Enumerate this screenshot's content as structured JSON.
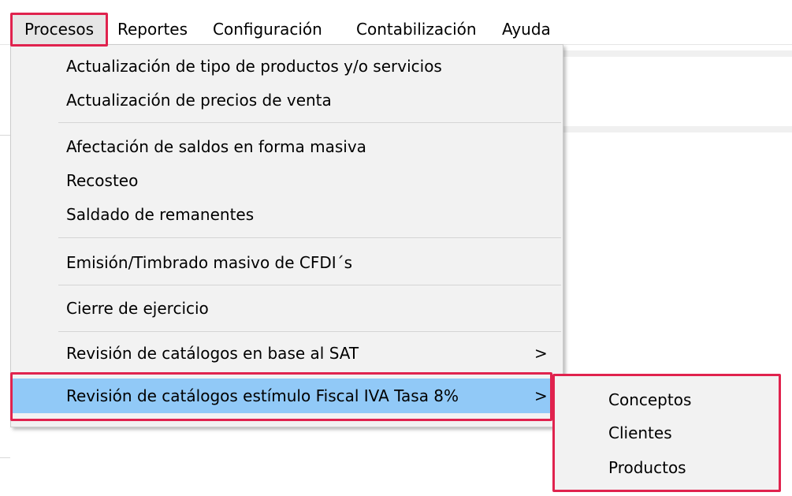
{
  "menubar": {
    "items": [
      {
        "label": "Procesos"
      },
      {
        "label": "Reportes"
      },
      {
        "label": "Configuración"
      },
      {
        "label": "Contabilización"
      },
      {
        "label": "Ayuda"
      }
    ]
  },
  "dropdown": {
    "items": [
      {
        "label": "Actualización de tipo de productos y/o servicios"
      },
      {
        "label": "Actualización de precios de venta"
      },
      {
        "label": "Afectación de saldos en forma masiva"
      },
      {
        "label": "Recosteo"
      },
      {
        "label": "Saldado de remanentes"
      },
      {
        "label": "Emisión/Timbrado masivo de CFDI´s"
      },
      {
        "label": "Cierre de ejercicio"
      },
      {
        "label": "Revisión de catálogos en base al SAT",
        "arrow": ">"
      },
      {
        "label": "Revisión de catálogos estímulo Fiscal IVA Tasa 8%",
        "arrow": ">"
      }
    ]
  },
  "submenu": {
    "items": [
      {
        "label": "Conceptos"
      },
      {
        "label": "Clientes"
      },
      {
        "label": "Productos"
      }
    ]
  },
  "colors": {
    "highlight_box": "#e0234e",
    "selected_item": "#91c9f7",
    "menu_background": "#f2f2f2"
  }
}
